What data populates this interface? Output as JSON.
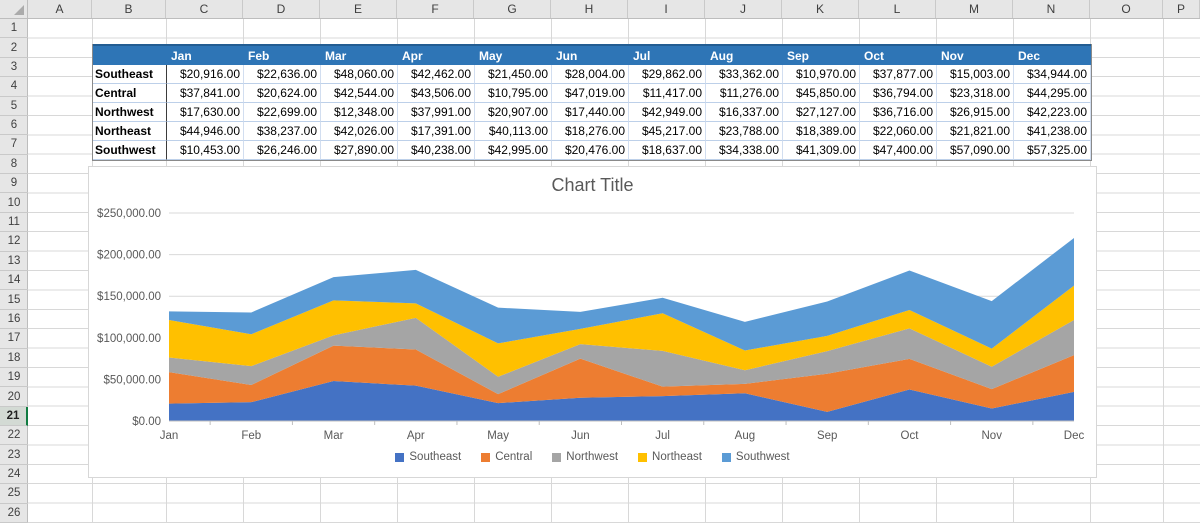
{
  "sheet": {
    "columns": [
      "A",
      "B",
      "C",
      "D",
      "E",
      "F",
      "G",
      "H",
      "I",
      "J",
      "K",
      "L",
      "M",
      "N",
      "O",
      "P"
    ],
    "rows_visible": 26,
    "active_row": 21,
    "gridline_color": "#D8D8D8",
    "header_bg": "#E6E6E6"
  },
  "table": {
    "header_fill": "#2E75B6",
    "header_text_color": "#FFFFFF",
    "corner_cell": "",
    "region_column": [
      "Southeast",
      "Central",
      "Northwest",
      "Northeast",
      "Southwest"
    ]
  },
  "chart_data": {
    "type": "area",
    "stacked": true,
    "title": "Chart Title",
    "categories": [
      "Jan",
      "Feb",
      "Mar",
      "Apr",
      "May",
      "Jun",
      "Jul",
      "Aug",
      "Sep",
      "Oct",
      "Nov",
      "Dec"
    ],
    "series": [
      {
        "name": "Southeast",
        "color": "#4472C4",
        "values": [
          20916,
          22636,
          48060,
          42462,
          21450,
          28004,
          29862,
          33362,
          10970,
          37877,
          15003,
          34944
        ]
      },
      {
        "name": "Central",
        "color": "#ED7D31",
        "values": [
          37841,
          20624,
          42544,
          43506,
          10795,
          47019,
          11417,
          11276,
          45850,
          36794,
          23318,
          44295
        ]
      },
      {
        "name": "Northwest",
        "color": "#A5A5A5",
        "values": [
          17630,
          22699,
          12348,
          37991,
          20907,
          17440,
          42949,
          16337,
          27127,
          36716,
          26915,
          42223
        ]
      },
      {
        "name": "Northeast",
        "color": "#FFC000",
        "values": [
          44946,
          38237,
          42026,
          17391,
          40113,
          18276,
          45217,
          23788,
          18389,
          22060,
          21821,
          41238
        ]
      },
      {
        "name": "Southwest",
        "color": "#5B9BD5",
        "values": [
          10453,
          26246,
          27890,
          40238,
          42995,
          20476,
          18637,
          34338,
          41309,
          47400,
          57090,
          57325
        ]
      }
    ],
    "ylim": [
      0,
      250000
    ],
    "y_step": 50000,
    "y_tick_labels": [
      "$0.00",
      "$50,000.00",
      "$100,000.00",
      "$150,000.00",
      "$200,000.00",
      "$250,000.00"
    ],
    "value_format": "currency_2dp",
    "grid": true,
    "legend_position": "bottom",
    "title_color": "#595959",
    "axis_text_color": "#595959",
    "gridline_color": "#D9D9D9",
    "axis_line_color": "#BFBFBF"
  }
}
